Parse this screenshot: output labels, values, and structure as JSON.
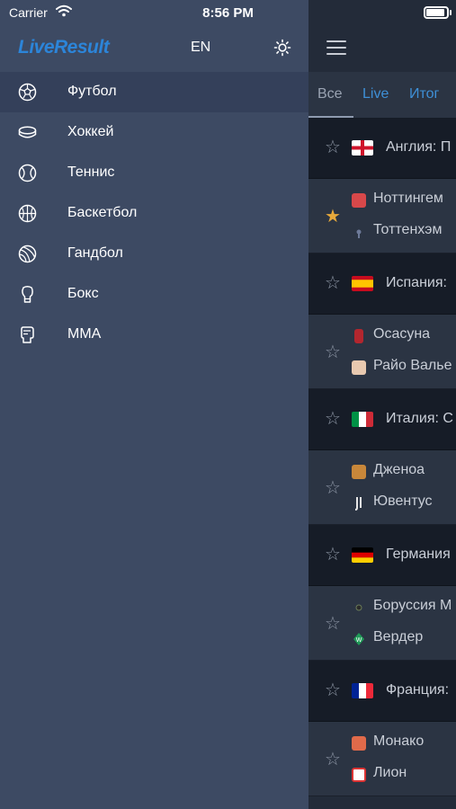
{
  "status_bar": {
    "carrier": "Carrier",
    "time": "8:56 PM"
  },
  "drawer": {
    "logo": "LiveResult",
    "language": "EN",
    "sports": [
      {
        "label": "Футбол",
        "icon": "soccer-ball-icon",
        "active": true
      },
      {
        "label": "Хоккей",
        "icon": "hockey-puck-icon"
      },
      {
        "label": "Теннис",
        "icon": "tennis-ball-icon"
      },
      {
        "label": "Баскетбол",
        "icon": "basketball-icon"
      },
      {
        "label": "Гандбол",
        "icon": "handball-icon"
      },
      {
        "label": "Бокс",
        "icon": "boxing-glove-icon"
      },
      {
        "label": "MMA",
        "icon": "mma-glove-icon"
      }
    ]
  },
  "main": {
    "tabs": [
      {
        "label": "Все"
      },
      {
        "label": "Live"
      },
      {
        "label": "Итог"
      }
    ],
    "leagues": [
      {
        "name": "Англия: П",
        "flag": "england",
        "match": {
          "starred": true,
          "home": "Ноттингем",
          "away": "Тоттенхэм"
        }
      },
      {
        "name": "Испания:",
        "flag": "spain",
        "match": {
          "starred": false,
          "home": "Осасуна",
          "away": "Райо Валье"
        }
      },
      {
        "name": "Италия: С",
        "flag": "italy",
        "match": {
          "starred": false,
          "home": "Дженоа",
          "away": "Ювентус"
        }
      },
      {
        "name": "Германия",
        "flag": "germany",
        "match": {
          "starred": false,
          "home": "Боруссия М",
          "away": "Вердер"
        }
      },
      {
        "name": "Франция:",
        "flag": "france",
        "match": {
          "starred": false,
          "home": "Монако",
          "away": "Лион"
        }
      }
    ]
  },
  "colors": {
    "accent": "#2c85d9",
    "drawer_bg": "#3d4a63",
    "star_active": "#e7a93b"
  }
}
